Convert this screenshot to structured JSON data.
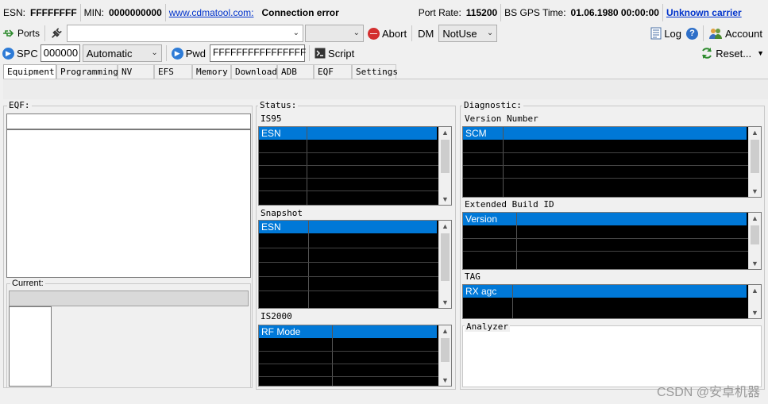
{
  "status": {
    "esn_label": "ESN:",
    "esn_value": "FFFFFFFF",
    "min_label": "MIN:",
    "min_value": "0000000000",
    "site_link": "www.cdmatool.com:",
    "connection_status": "Connection error",
    "port_rate_label": "Port Rate:",
    "port_rate_value": "115200",
    "bs_gps_label": "BS GPS Time:",
    "bs_gps_value": "01.06.1980 00:00:00",
    "carrier": "Unknown carrier"
  },
  "toolbar1": {
    "ports_label": "Ports",
    "abort_label": "Abort",
    "dm_label": "DM",
    "dm_value": "NotUse",
    "log_label": "Log",
    "account_label": "Account"
  },
  "toolbar2": {
    "spc_label": "SPC",
    "spc_value": "000000",
    "mode_value": "Automatic",
    "pwd_label": "Pwd",
    "pwd_value": "FFFFFFFFFFFFFFFF",
    "script_label": "Script",
    "reset_label": "Reset..."
  },
  "tabs": [
    "Equipment",
    "Programming",
    "NV",
    "EFS",
    "Memory",
    "Download",
    "ADB",
    "EQF",
    "Settings"
  ],
  "eqf_panel": {
    "title": "EQF:",
    "current_label": "Current:"
  },
  "status_panel": {
    "title": "Status:",
    "is95_label": "IS95",
    "is95_header": "ESN",
    "snapshot_label": "Snapshot",
    "snapshot_header": "ESN",
    "is2000_label": "IS2000",
    "is2000_header": "RF Mode"
  },
  "diagnostic_panel": {
    "title": "Diagnostic:",
    "version_label": "Version Number",
    "version_header": "SCM",
    "extbuild_label": "Extended Build ID",
    "extbuild_header": "Version",
    "tag_label": "TAG",
    "tag_header": "RX agc",
    "analyzer_label": "Analyzer"
  },
  "watermark": "CSDN @安卓机器",
  "colors": {
    "selection": "#0078d7",
    "grid_bg": "#000000",
    "link": "#0033cc",
    "abort": "#d32f2f",
    "play": "#2e7bd6"
  }
}
